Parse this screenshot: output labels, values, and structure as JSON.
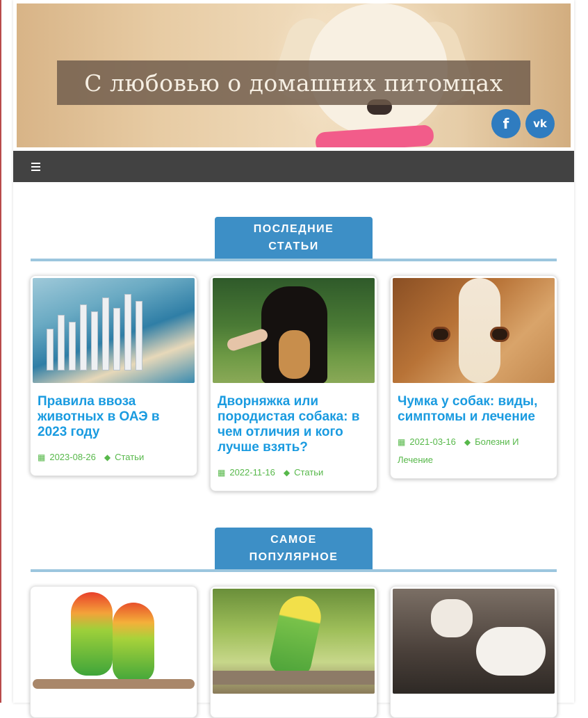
{
  "site": {
    "title": "С любовью о домашних питомцах",
    "social": [
      {
        "name": "facebook",
        "glyph": "f"
      },
      {
        "name": "vk",
        "glyph": "vk"
      }
    ]
  },
  "nav": {
    "menu_icon": "bars-icon"
  },
  "sections": [
    {
      "heading_line1": "ПОСЛЕДНИЕ",
      "heading_line2": "СТАТЬИ",
      "cards": [
        {
          "title": "Правила ввоза животных в ОАЭ в 2023 году",
          "date": "2023-08-26",
          "category": "Статьи",
          "image": "dubai-coast-photo"
        },
        {
          "title": "Дворняжка или породистая собака: в чем отличия и кого лучше взять?",
          "date": "2022-11-16",
          "category": "Статьи",
          "image": "dog-paw-photo"
        },
        {
          "title": "Чумка у собак: виды, симптомы и лечение",
          "date": "2021-03-16",
          "category": "Болезни И Лечение",
          "image": "beagle-photo"
        }
      ]
    },
    {
      "heading_line1": "САМОЕ",
      "heading_line2": "ПОПУЛЯРНОЕ",
      "cards": [
        {
          "image": "lovebirds-photo"
        },
        {
          "image": "budgie-photo"
        },
        {
          "image": "white-cat-photo"
        }
      ]
    }
  ],
  "colors": {
    "accent": "#3d8fc6",
    "link": "#1a9be0",
    "meta": "#57b84a",
    "navbar": "#424242"
  }
}
